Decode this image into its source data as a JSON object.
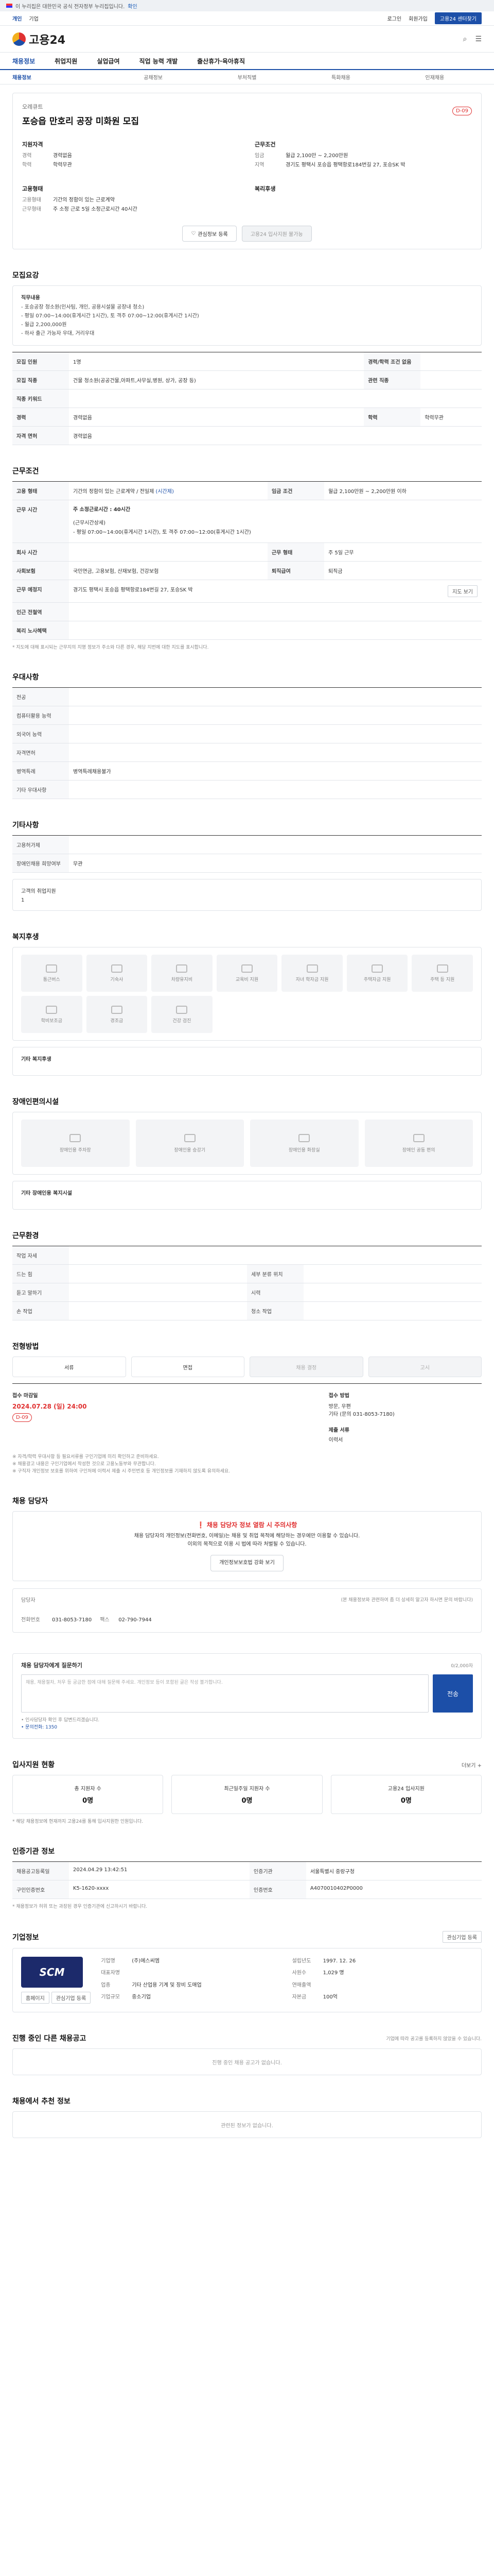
{
  "topbar": {
    "notice": "이 누리집은 대한민국 공식 전자정부 누리집입니다.",
    "link": "확인"
  },
  "govbar": {
    "left": "개인",
    "left2": "기업",
    "items": [
      "로그인",
      "회원가입",
      "고용24 센터찾기"
    ]
  },
  "header": {
    "logo": "고용24"
  },
  "gnb": [
    "채용정보",
    "취업지원",
    "실업급여",
    "직업 능력 개발",
    "출산휴가·육아휴직"
  ],
  "subnav": [
    "채용정보",
    "공채정보",
    "부처직별",
    "특화채용",
    "인재채용"
  ],
  "job": {
    "company": "오레큐트",
    "title": "포승읍 만호리 공장 미화원 모집",
    "dday": "D-09",
    "left_sec": "지원자격",
    "left": [
      [
        "경력",
        "경력없음"
      ],
      [
        "학력",
        "학력무관"
      ]
    ],
    "left_sec2": "고용형태",
    "left2": [
      [
        "고용형태",
        "기간의 정함이 있는 근로계약"
      ],
      [
        "근무형태",
        "주 소정 근로 5일 소정근로시간 40시간"
      ]
    ],
    "right_sec": "근무조건",
    "right": [
      [
        "임금",
        "월급 2,100만 ~ 2,200만원"
      ],
      [
        "지역",
        "경기도 평택시 포승읍 평택항로184번길 27, 포승SK 박"
      ]
    ],
    "right_sec2": "복리후생",
    "btn_interest": "관심정보 등록",
    "btn_apply": "고용24 입사지원 불가능"
  },
  "recruit": {
    "title": "모집요강",
    "duty_label": "직무내용",
    "duty": [
      "- 포승공장 청소원(인사팀, 개인, 공용시설물 공장내 청소)",
      "- 평일 07:00~14:00(휴게시간 1시간), 토 격주 07:00~12:00(휴게시간 1시간)",
      "- 월급 2,200,000원",
      "- 하사 출근 가능자 우대, 거리우대"
    ],
    "rows": [
      [
        "모집 인원",
        "1명",
        "경력/학력 조건 없음",
        ""
      ],
      [
        "모집 직종",
        "건물 청소원(공공건물,아파트,사무실,병원, 상가, 공장 등)",
        "관련 직종",
        ""
      ],
      [
        "직종 키워드",
        "",
        "",
        ""
      ],
      [
        "경력",
        "경력없음",
        "학력",
        "학력무관"
      ],
      [
        "자격 면허",
        "경력없음",
        "",
        ""
      ]
    ]
  },
  "conditions": {
    "title": "근무조건",
    "type_label": "고용 형태",
    "type_val": "기간의 정함이 있는 근로계약 / 전일제",
    "type_val2": "(시간제)",
    "wage_label": "임금 조건",
    "wage_val": "월급 2,100만원 ~ 2,200만원 이하",
    "hours_label": "근무 시간",
    "hours_main": "주 소정근로시간 : 40시간",
    "hours_detail_label": "(근무시간상세)",
    "hours_detail": "- 평일 07:00~14:00(휴게시간 1시간), 토 격주 07:00~12:00(휴게시간 1시간)",
    "rows": [
      [
        "회사 시간",
        "",
        "근무 형태",
        "주 5일 근무"
      ],
      [
        "사회보험",
        "국민연금, 고용보험, 산재보험, 건강보험",
        "퇴직급여",
        "퇴직금"
      ],
      [
        "근무 예정지",
        "경기도 평택시 포승읍 평택항로184번길 27, 포승SK 박",
        "",
        ""
      ],
      [
        "인근 전철역",
        "",
        "",
        ""
      ],
      [
        "복리 노사혜택",
        "",
        "",
        ""
      ]
    ],
    "map_btn": "지도 보기",
    "note": "* 지도에 대해 표시되는 근무지의 지명 정보가 주소와 다른 경우, 해당 지번에 대한 지도를 표시합니다."
  },
  "preference": {
    "title": "우대사항",
    "rows": [
      [
        "전공",
        ""
      ],
      [
        "컴퓨터활용 능력",
        ""
      ],
      [
        "외국어 능력",
        ""
      ],
      [
        "자격면허",
        ""
      ],
      [
        "병역특례",
        "병역특례채용불가"
      ],
      [
        "기타 우대사항",
        ""
      ]
    ]
  },
  "etc": {
    "title": "기타사항",
    "rows": [
      [
        "고용허가제",
        ""
      ],
      [
        "장애인채용 희망여부",
        "무관"
      ]
    ],
    "link": "고객의 취업지원",
    "link2": "1"
  },
  "welfare": {
    "title": "복지후생",
    "items": [
      "통근버스",
      "기숙사",
      "차량유지비",
      "교육비 지원",
      "자녀 학자금 지원",
      "주택자금 지원",
      "주택 등 지원",
      "학비보조금",
      "경조금",
      "건강 검진"
    ],
    "etc_label": "기타 복지후생"
  },
  "disability": {
    "title": "장애인편의시설",
    "items": [
      "장애인용 주차장",
      "장애인용 승강기",
      "장애인용 화장실",
      "장애인 공동 편의"
    ],
    "etc_label": "기타 장애인용 복지시설"
  },
  "worktype": {
    "title": "근무환경",
    "rows": [
      [
        "작업 자세",
        "",
        "",
        ""
      ],
      [
        "드는 힘",
        "",
        "세부 분류 위치",
        ""
      ],
      [
        "듣고 말하기",
        "",
        "시력",
        ""
      ],
      [
        "손 작업",
        "",
        "청소 작업",
        ""
      ]
    ]
  },
  "process": {
    "title": "전형방법",
    "steps": [
      "서류",
      "면접",
      "채용 결정",
      "고시"
    ],
    "deadline_label": "접수 마감일",
    "deadline": "2024.07.28 (일) 24:00",
    "dday": "D-09",
    "method_label": "접수 방법",
    "method": "방문, 우편",
    "method2": "기타 (문의 031-8053-7180)",
    "docs_label": "제출 서류",
    "docs": "이력서",
    "notes": [
      "※ 자격/학력 우대사항 등 필요서류를 구인기업에 미리 확인하고 준비하세요.",
      "※ 채용광고 내용은 구인기업에서 작성한 것으로 고용노동부와 무관합니다.",
      "※ 구직자 개인정보 보호를 위하여 구인처에 이력서 제출 시 주민번호 등 개인정보를 기재하지 않도록 유의하세요."
    ]
  },
  "contact": {
    "title": "채용 담당자",
    "alert_title": "채용 담당자 정보 열람 시 주의사항",
    "alert_body": "채용 담당자의 개인정보(전화번호, 이메일)는 채용 및 취업 목적에 해당하는 경우에만 이용할 수 있습니다.",
    "alert_body2": "이외의 목적으로 이용 시 법에 따라 처벌될 수 있습니다.",
    "btn": "개인정보보호법 강화 보기",
    "kv": [
      [
        "담당자",
        ""
      ],
      [
        "전화번호",
        "031-8053-7180"
      ],
      [
        "팩스",
        "02-790-7944"
      ]
    ],
    "right_note": "(본 채용정보와 관련하여 좀 더 상세히 알고자 하시면 문의 바랍니다)"
  },
  "inquiry": {
    "title": "채용 담당자에게 질문하기",
    "count": "0/2,000자",
    "placeholder": "채용, 채용절차, 처우 등 궁금한 점에 대해 질문해 주세요. 개인정보 등이 포함된 글은 작성 불가합니다.",
    "send": "전송",
    "notes": [
      "• 인사담당자 확인 후 답변드리겠습니다.",
      "• 문의전화: 1350"
    ]
  },
  "stats": {
    "title": "입사지원 현황",
    "items": [
      {
        "label": "총 지원자 수",
        "val": "0명"
      },
      {
        "label": "최근일주일 지원자 수",
        "val": "0명"
      },
      {
        "label": "고용24 입사지원",
        "val": "0명"
      }
    ],
    "note": "* 해당 채용정보에 현재까지 고용24를 통해 입사지원한 인원입니다.",
    "more": "더보기 +"
  },
  "org": {
    "title": "인증기관 정보",
    "rows": [
      [
        "채용공고등록일",
        "2024.04.29 13:42:51",
        "인증기관",
        "서울특별시 중랑구청"
      ],
      [
        "구인인증번호",
        "K5-1620-xxxx",
        "인증번호",
        "A4070010402P0000"
      ]
    ],
    "notes": [
      "* 채용정보가 허위 또는 과장된 경우 인증기관에 신고하시기 바랍니다."
    ]
  },
  "company": {
    "title": "기업정보",
    "btn": "관심기업 등록",
    "logo": "SCM",
    "rows": [
      [
        "기업명",
        "(주)에스씨엠"
      ],
      [
        "대표자명",
        ""
      ],
      [
        "업종",
        "기타 산업용 기계 및 장비 도매업"
      ],
      [
        "기업규모",
        "중소기업"
      ],
      [
        "설립년도",
        "1997. 12. 26"
      ],
      [
        "사원수",
        "1,029 명"
      ],
      [
        "연매출액",
        ""
      ],
      [
        "자본금",
        "100억"
      ]
    ],
    "btn2": "홈페이지",
    "btn3": "관심기업 등록"
  },
  "others": {
    "title": "진행 중인 다른 채용공고",
    "empty": "진행 중인 채용 공고가 없습니다.",
    "note": "기업에 따라 공고를 등록하지 않았을 수 있습니다."
  },
  "recommend": {
    "title": "채용에서 추천 정보",
    "empty": "관련된 정보가 없습니다."
  }
}
